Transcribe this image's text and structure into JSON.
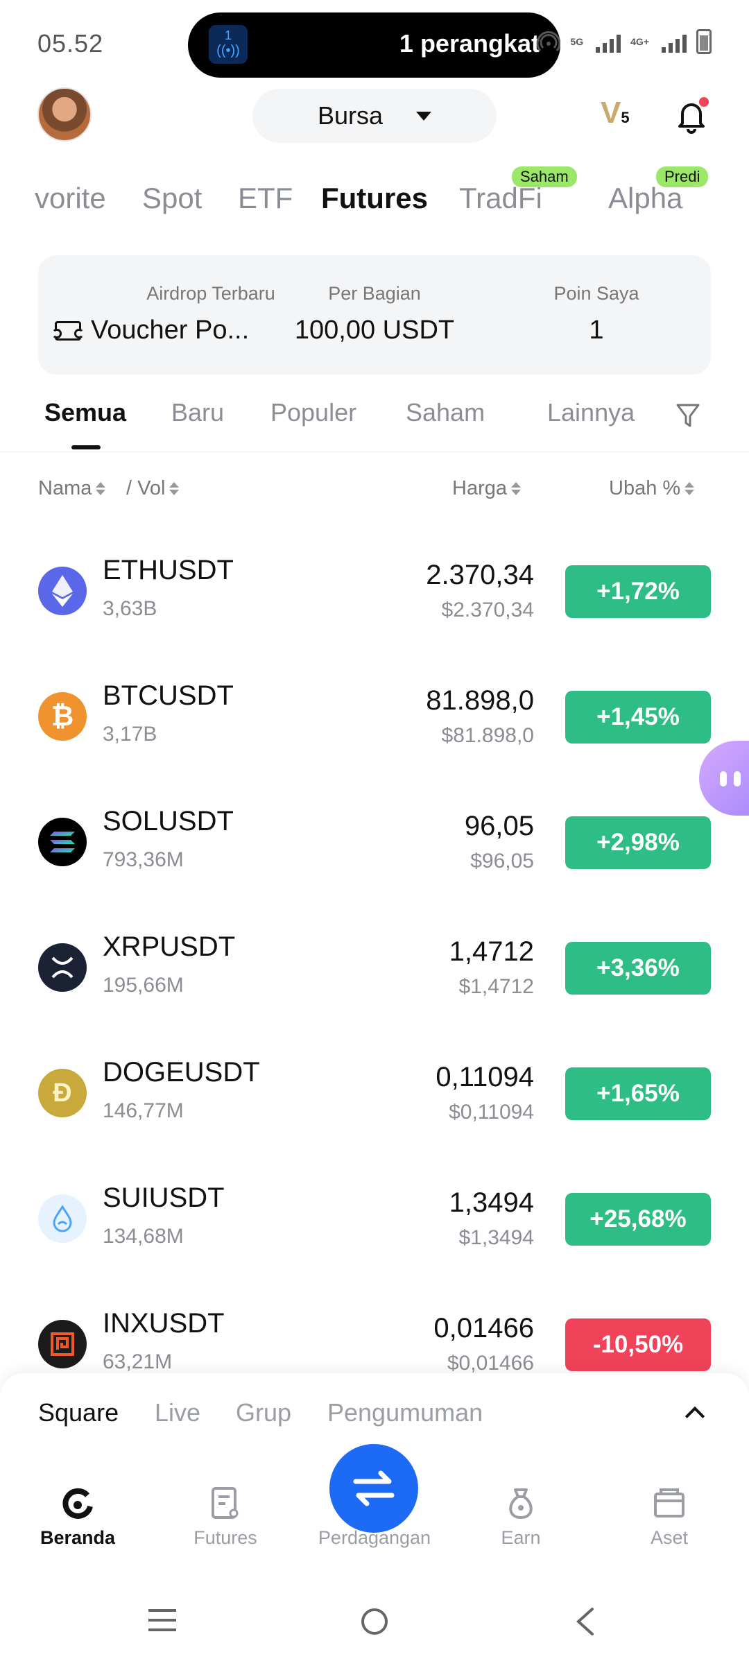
{
  "status": {
    "time": "05.52",
    "island_count": "1",
    "island_text": "1 perangkat",
    "net1": "5G",
    "net2": "4G+"
  },
  "header": {
    "exchange_label": "Bursa",
    "vip_letter": "V",
    "vip_level": "5"
  },
  "top_tabs": [
    {
      "label": "vorite"
    },
    {
      "label": "Spot"
    },
    {
      "label": "ETF"
    },
    {
      "label": "Futures",
      "active": true
    },
    {
      "label": "TradFi",
      "tag": "Saham"
    },
    {
      "label": "Alpha",
      "tag": "Predi"
    }
  ],
  "airdrop": {
    "col1_label": "Airdrop Terbaru",
    "col1_value": "Voucher Po...",
    "col2_label": "Per Bagian",
    "col2_value": "100,00 USDT",
    "col3_label": "Poin Saya",
    "col3_value": "1"
  },
  "category_tabs": [
    "Semua",
    "Baru",
    "Populer",
    "Saham",
    "Lainnya"
  ],
  "columns": {
    "name": "Nama",
    "vol": "/ Vol",
    "price": "Harga",
    "change": "Ubah %"
  },
  "colors": {
    "up": "#2ebd85",
    "down": "#f0435a",
    "accent": "#1d6bf5"
  },
  "rows": [
    {
      "symbol": "ETHUSDT",
      "volume": "3,63B",
      "price": "2.370,34",
      "price_usd": "$2.370,34",
      "change": "+1,72%",
      "dir": "up",
      "icon": "ethereum-icon"
    },
    {
      "symbol": "BTCUSDT",
      "volume": "3,17B",
      "price": "81.898,0",
      "price_usd": "$81.898,0",
      "change": "+1,45%",
      "dir": "up",
      "icon": "bitcoin-icon"
    },
    {
      "symbol": "SOLUSDT",
      "volume": "793,36M",
      "price": "96,05",
      "price_usd": "$96,05",
      "change": "+2,98%",
      "dir": "up",
      "icon": "solana-icon"
    },
    {
      "symbol": "XRPUSDT",
      "volume": "195,66M",
      "price": "1,4712",
      "price_usd": "$1,4712",
      "change": "+3,36%",
      "dir": "up",
      "icon": "xrp-icon"
    },
    {
      "symbol": "DOGEUSDT",
      "volume": "146,77M",
      "price": "0,11094",
      "price_usd": "$0,11094",
      "change": "+1,65%",
      "dir": "up",
      "icon": "doge-icon"
    },
    {
      "symbol": "SUIUSDT",
      "volume": "134,68M",
      "price": "1,3494",
      "price_usd": "$1,3494",
      "change": "+25,68%",
      "dir": "up",
      "icon": "sui-icon"
    },
    {
      "symbol": "INXUSDT",
      "volume": "63,21M",
      "price": "0,01466",
      "price_usd": "$0,01466",
      "change": "-10,50%",
      "dir": "down",
      "icon": "inx-icon"
    }
  ],
  "feed_tabs": [
    "Square",
    "Live",
    "Grup",
    "Pengumuman"
  ],
  "nav": {
    "home": "Beranda",
    "futures": "Futures",
    "trade": "Perdagangan",
    "earn": "Earn",
    "assets": "Aset"
  }
}
